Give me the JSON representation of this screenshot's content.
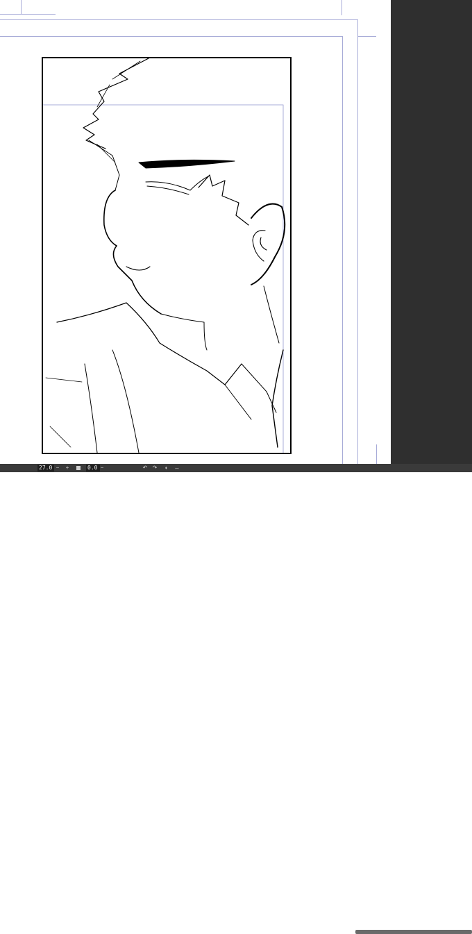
{
  "status_bar": {
    "zoom_value": "27.0",
    "zoom_out_icon": "minus-icon",
    "zoom_in_icon": "plus-icon",
    "fit_icon": "square-icon",
    "rotation_value": "0.0",
    "rotate_left_icon": "rotate-left-icon",
    "rotate_right_icon": "rotate-right-icon",
    "reset_rotation_icon": "reset-icon",
    "flip_icon": "flip-icon"
  },
  "colors": {
    "side_panel": "#2f2f2f",
    "guide_lines": "#a8acd8",
    "status_bar": "#3a3a3a"
  }
}
